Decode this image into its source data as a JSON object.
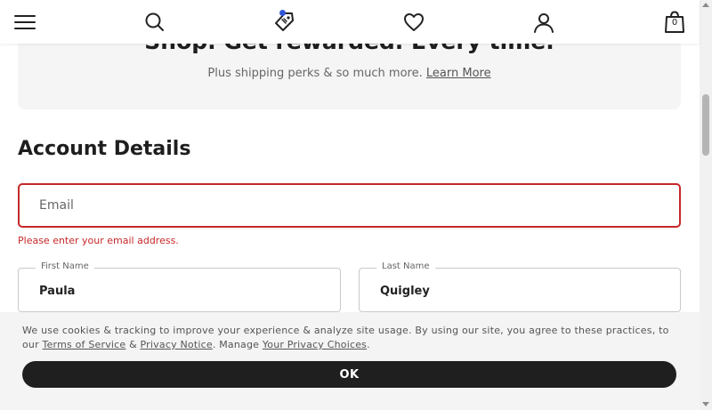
{
  "header": {
    "icons": [
      "menu-icon",
      "search-icon",
      "tag-icon",
      "heart-icon",
      "account-icon",
      "shopping-bag-icon"
    ],
    "bag_count": "0",
    "accent_color": "#2f56d6"
  },
  "promo": {
    "title": "Shop. Get rewarded. Every time.",
    "subtitle": "Plus shipping perks & so much more.",
    "learn_more": "Learn More"
  },
  "account": {
    "title": "Account Details",
    "email": {
      "placeholder": "Email",
      "value": "",
      "error": "Please enter your email address.",
      "error_color": "#c62828"
    },
    "first_name": {
      "label": "First Name",
      "value": "Paula"
    },
    "last_name": {
      "label": "Last Name",
      "value": "Quigley"
    }
  },
  "cookie": {
    "text_start": "We use cookies & tracking to improve your experience & analyze site usage. By using our site, you agree to these practices, to our ",
    "terms_link": "Terms of Service",
    "amp": " & ",
    "privacy_link": "Privacy Notice",
    "manage_text": ". Manage ",
    "choices_link": "Your Privacy Choices",
    "end_text": ".",
    "ok_label": "OK"
  }
}
